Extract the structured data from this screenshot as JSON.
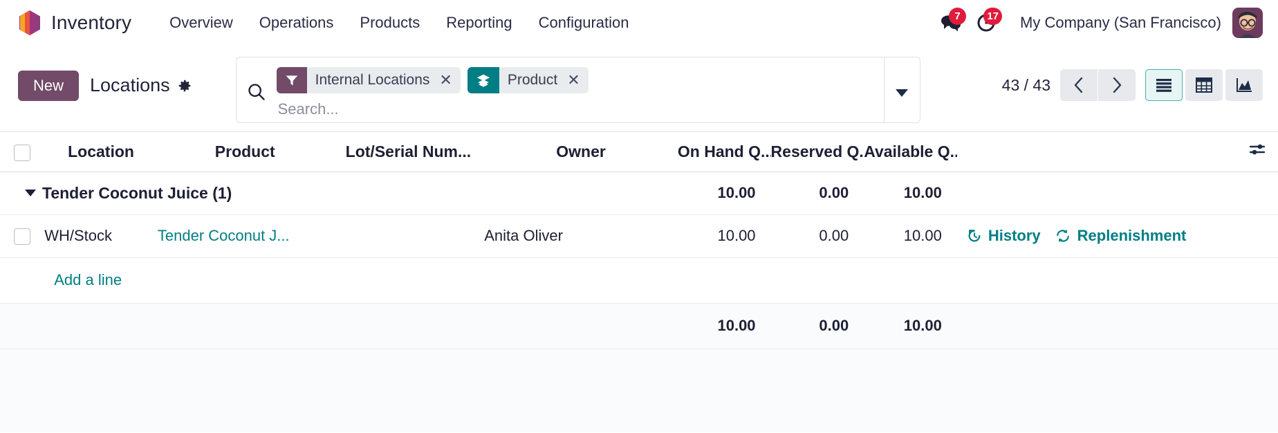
{
  "navbar": {
    "brand": "Inventory",
    "logo_icon": "odoo-cube-icon",
    "menu": [
      {
        "label": "Overview"
      },
      {
        "label": "Operations"
      },
      {
        "label": "Products"
      },
      {
        "label": "Reporting"
      },
      {
        "label": "Configuration"
      }
    ],
    "messages_icon": "chat-bubbles-icon",
    "messages_count": "7",
    "activities_icon": "clock-icon",
    "activities_count": "17",
    "company": "My Company (San Francisco)",
    "avatar_icon": "user-avatar"
  },
  "control_panel": {
    "new_label": "New",
    "title": "Locations",
    "gear_icon": "gear-icon",
    "search_icon": "search-icon",
    "search_placeholder": "Search...",
    "search_value": "",
    "dropdown_icon": "chevron-down-icon",
    "facets": [
      {
        "icon": "filter-icon",
        "kind": "filter",
        "label": "Internal Locations",
        "close_icon": "close-icon"
      },
      {
        "icon": "layers-icon",
        "kind": "group",
        "label": "Product",
        "close_icon": "close-icon"
      }
    ],
    "pager": "43 / 43",
    "pager_prev_icon": "chevron-left-icon",
    "pager_next_icon": "chevron-right-icon",
    "views": [
      {
        "name": "list",
        "icon": "list-view-icon",
        "active": true
      },
      {
        "name": "pivot",
        "icon": "pivot-view-icon",
        "active": false
      },
      {
        "name": "graph",
        "icon": "graph-view-icon",
        "active": false
      }
    ]
  },
  "table": {
    "select_all_icon": "checkbox",
    "optional_columns_icon": "settings-sliders-icon",
    "columns": [
      "Location",
      "Product",
      "Lot/Serial Num...",
      "Owner",
      "On Hand Q...",
      "Reserved Q...",
      "Available Q..."
    ],
    "group": {
      "caret_icon": "caret-down-icon",
      "label": "Tender Coconut Juice (1)",
      "on_hand": "10.00",
      "reserved": "0.00",
      "available": "10.00"
    },
    "rows": [
      {
        "location": "WH/Stock",
        "product": "Tender Coconut J...",
        "lot_serial": "",
        "owner": "Anita Oliver",
        "on_hand": "10.00",
        "reserved": "0.00",
        "available": "10.00",
        "history_icon": "history-icon",
        "history_label": "History",
        "replenishment_icon": "refresh-icon",
        "replenishment_label": "Replenishment"
      }
    ],
    "add_line_label": "Add a line",
    "footer": {
      "on_hand": "10.00",
      "reserved": "0.00",
      "available": "10.00"
    }
  },
  "colors": {
    "brand_purple": "#714b67",
    "accent_teal": "#017e84",
    "badge_red": "#e01b3c"
  }
}
